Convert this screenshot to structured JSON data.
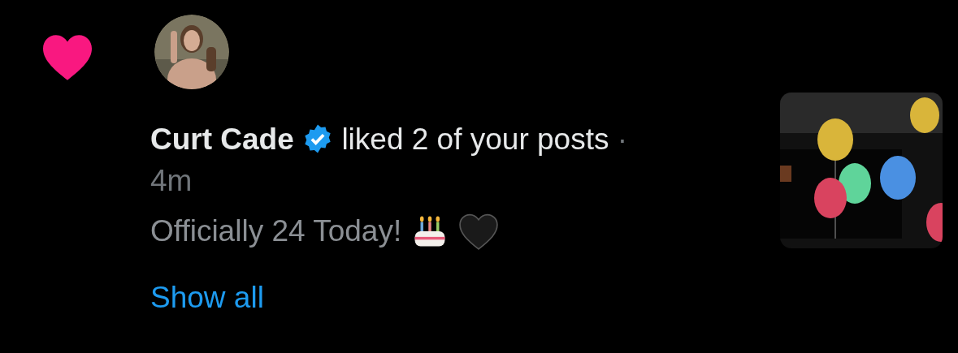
{
  "notification": {
    "kind": "like",
    "user": {
      "name": "Curt Cade",
      "verified": true
    },
    "action": "liked 2 of your posts",
    "separator": "·",
    "time": "4m",
    "post_text": "Officially 24 Today!",
    "post_emojis": [
      {
        "kind": "cake"
      },
      {
        "kind": "black_heart"
      }
    ],
    "show_all": "Show all"
  }
}
